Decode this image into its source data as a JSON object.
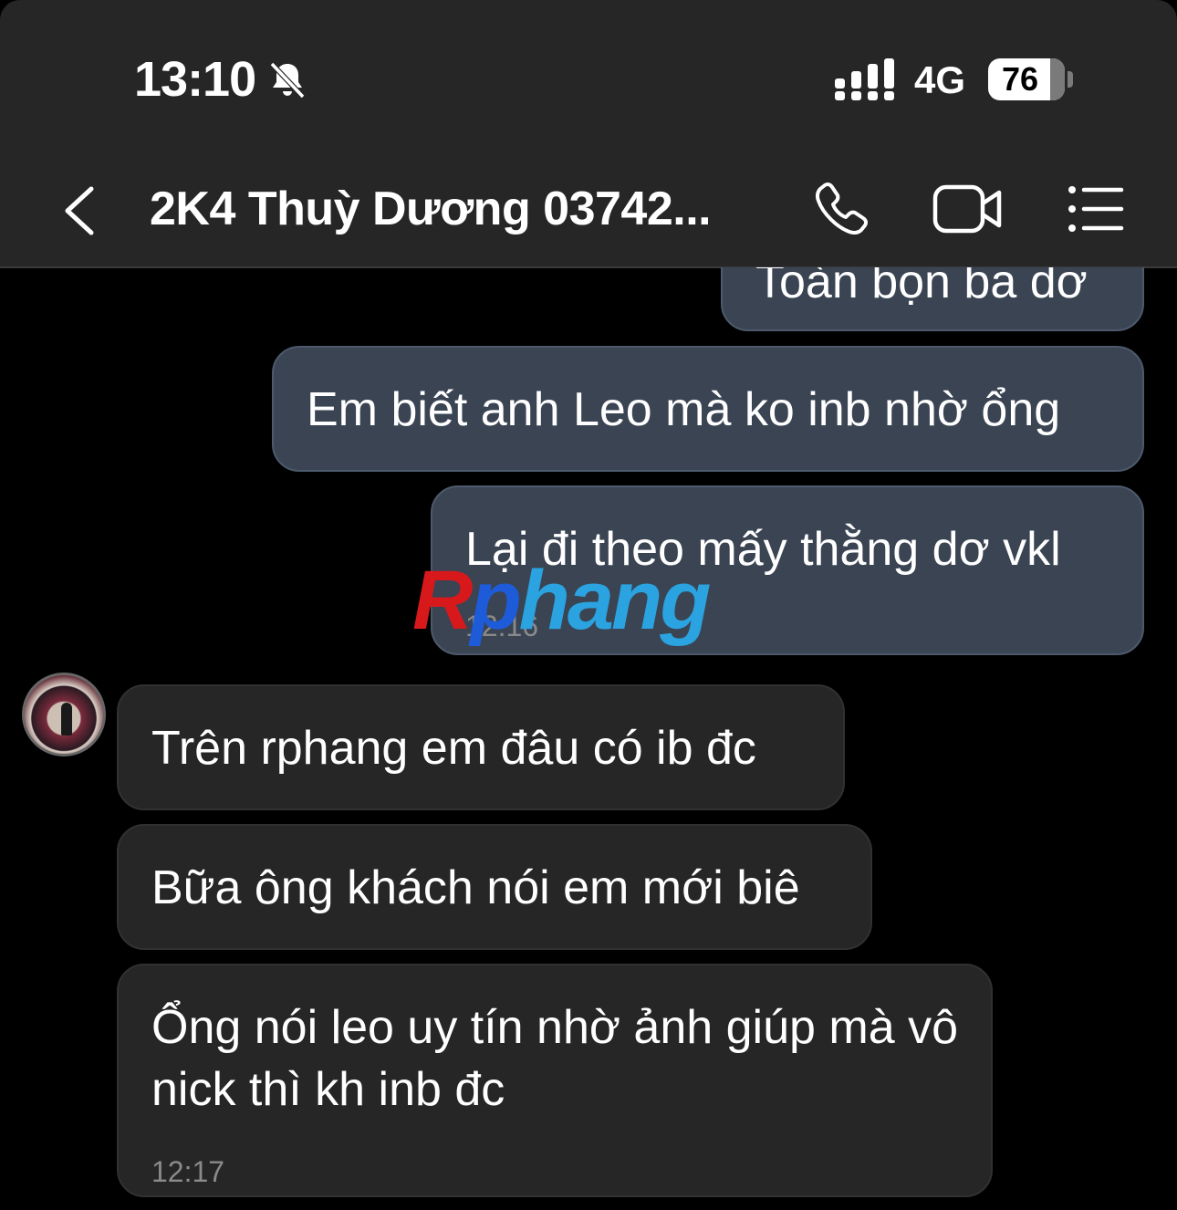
{
  "status_bar": {
    "time": "13:10",
    "network": "4G",
    "battery": "76"
  },
  "header": {
    "title": "2K4 Thuỳ Dương 03742..."
  },
  "messages": {
    "partial_outgoing": "Toàn bọn ba dơ",
    "out1": "Em biết anh Leo mà ko inb nhờ ổng",
    "out2": "Lại đi theo mấy thằng dơ vkl",
    "out2_time": "12:16",
    "in1": "Trên rphang em đâu có ib đc",
    "in2": "Bữa ông khách nói em mới biê",
    "in3": "Ổng nói leo uy tín nhờ ảnh giúp mà vô nick thì kh inb đc",
    "in3_time": "12:17"
  },
  "watermark": {
    "r": "R",
    "p": "p",
    "rest": "hang"
  },
  "icons": {
    "back": "chevron-left-icon",
    "call": "phone-icon",
    "video": "video-camera-icon",
    "menu": "list-icon",
    "mute": "bell-slash-icon",
    "signal": "signal-icon"
  },
  "colors": {
    "outgoing_bubble": "#3a4453",
    "incoming_bubble": "#262626",
    "bar": "#262626"
  }
}
